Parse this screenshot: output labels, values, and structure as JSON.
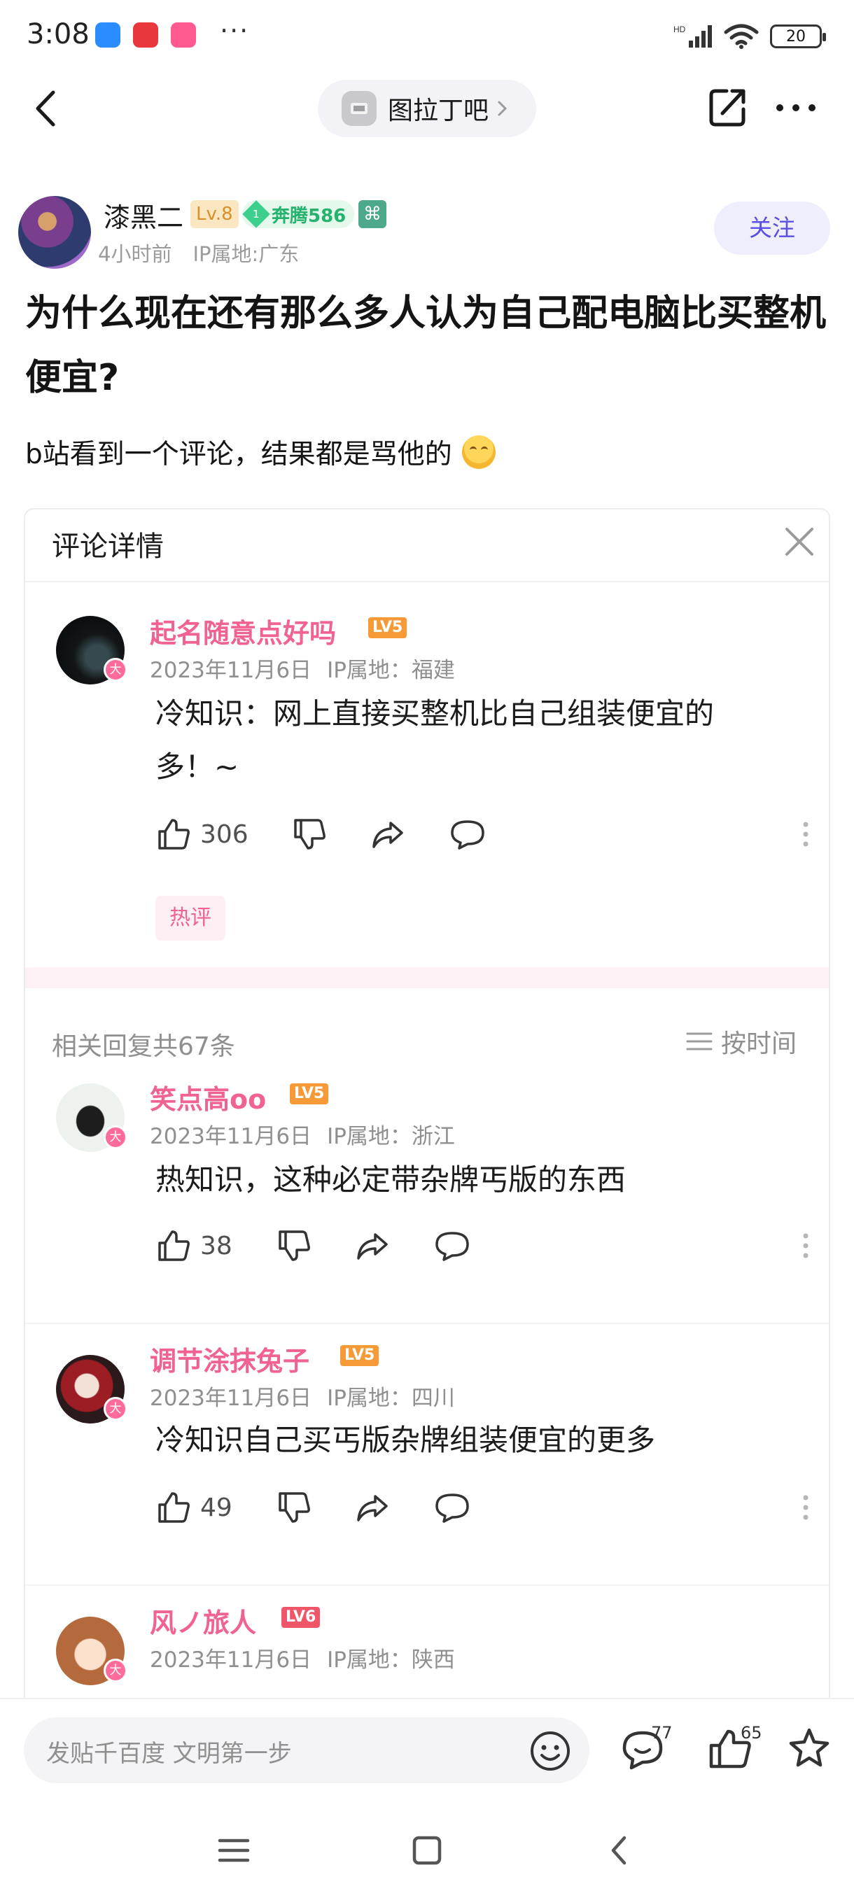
{
  "status_bar": {
    "time": "3:08",
    "battery": "20",
    "app_icon_colors": [
      "#2b8cff",
      "#e8383d",
      "#ff5a8f"
    ]
  },
  "nav": {
    "forum_name": "图拉丁吧"
  },
  "author": {
    "name": "漆黑二",
    "level": "Lv.8",
    "member_level": "1",
    "member_label": "奔腾586",
    "extra_badge": "⌘",
    "time_ago": "4小时前",
    "ip_location": "IP属地:广东",
    "follow_label": "关注"
  },
  "post": {
    "title": "为什么现在还有那么多人认为自己配电脑比买整机便宜?",
    "body": "b站看到一个评论，结果都是骂他的"
  },
  "card": {
    "title": "评论详情",
    "main_comment": {
      "user": "起名随意点好吗",
      "level": "LV5",
      "date": "2023年11月6日",
      "ip": "IP属地：福建",
      "badge": "大",
      "text_line1": "冷知识：网上直接买整机比自己组装便宜的",
      "text_line2": "多！~",
      "likes": "306",
      "hot_tag": "热评"
    },
    "replies_title": "相关回复共67条",
    "sort_label": "按时间",
    "replies": [
      {
        "user": "笑点高oo",
        "level": "LV5",
        "date": "2023年11月6日",
        "ip": "IP属地：浙江",
        "badge": "大",
        "text": "热知识，这种必定带杂牌丐版的东西",
        "likes": "38"
      },
      {
        "user": "调节涂抹兔子",
        "level": "LV5",
        "date": "2023年11月6日",
        "ip": "IP属地：四川",
        "badge": "大",
        "text": "冷知识自己买丐版杂牌组装便宜的更多",
        "likes": "49"
      },
      {
        "user": "风ノ旅人",
        "level": "LV6",
        "date": "2023年11月6日",
        "ip": "IP属地：陕西",
        "badge": "大"
      }
    ]
  },
  "bottom_bar": {
    "placeholder": "发贴千百度 文明第一步",
    "comment_count": "77",
    "like_count": "65"
  },
  "colors": {
    "accent_pink": "#f06292",
    "follow_purple": "#5a4fe0",
    "level_orange": "#f59a37"
  },
  "icons": [
    "back-icon",
    "chevron-right-icon",
    "share-icon",
    "more-icon",
    "close-icon",
    "thumb-up-icon",
    "thumb-down-icon",
    "forward-icon",
    "comment-icon",
    "sort-icon",
    "emoji-icon",
    "star-icon"
  ]
}
